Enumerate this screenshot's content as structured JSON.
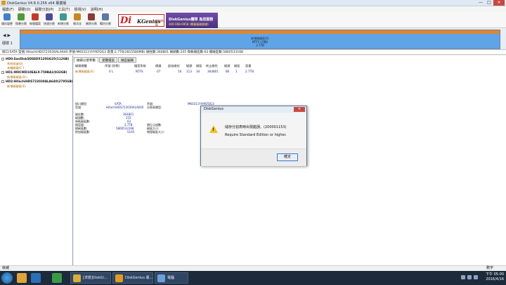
{
  "window": {
    "title": "DiskGenius V4.8.0.256 x64 專業版",
    "controls": [
      "—",
      "□",
      "×"
    ]
  },
  "menu": [
    "檔案(F)",
    "硬碟(D)",
    "磁碟分割(P)",
    "工具(T)",
    "檢視(V)",
    "說明(H)"
  ],
  "toolbar": [
    {
      "label": "儲存變更",
      "color": "#3f7fc9"
    },
    {
      "label": "搜尋分割",
      "color": "#4d9a3a"
    },
    {
      "label": "恢復檔案",
      "color": "#c23b2a"
    },
    {
      "label": "快速分割",
      "color": "#4b4b9a"
    },
    {
      "label": "新增分割",
      "color": "#3f9a8a"
    },
    {
      "label": "格式化",
      "color": "#c28a1c"
    },
    {
      "label": "刪除分割",
      "color": "#8a3a3a"
    },
    {
      "label": "備份分割",
      "color": "#5a7aa0"
    }
  ],
  "banner": {
    "logo_big": "Di",
    "logo_k": "KGenius",
    "logo_cn": "資料恢復",
    "ad_line1": "DiskGenius團隊 為您服務",
    "ad_line2": "400-008-9958 (專業服務熱線)"
  },
  "disk_bar": {
    "nav_arrows": "◀ ▶",
    "disk_label": "硬碟 1",
    "part_name": "新增磁碟區(E)",
    "part_fs": "NTFS (活動)",
    "part_size": "2.7TB"
  },
  "info_bar": "接口:SATA  型號:HitachiHDS723030ALA640  序號:MK0311YHYKFDG3  容量:2.7TB(2815580MB)  磁柱數:364801  磁頭數:255  每軌磁區數:63  總磁區數:5860533168",
  "tree": [
    {
      "type": "disk",
      "label": "HD0:SanDiskSDSSDX120GG25(112GB)"
    },
    {
      "type": "sub",
      "label": "系統保留(0)"
    },
    {
      "type": "sub",
      "label": "本機磁碟(C:)"
    },
    {
      "type": "disk",
      "label": "HD1:WDCWD10EALX-759BA1(932GB)"
    },
    {
      "type": "sub",
      "label": "新增磁碟區(D:)"
    },
    {
      "type": "disk",
      "label": "HD2:HitachiHDS723030ALA640(2795GB)"
    },
    {
      "type": "sub",
      "label": "新增磁碟區(E)"
    }
  ],
  "tabs": [
    "磁碟分割參數",
    "瀏覽檔案",
    "磁區編輯"
  ],
  "table": {
    "headers": [
      "磁碟標籤",
      "序號 (狀態)",
      "檔案系統",
      "標識",
      "起始磁柱",
      "磁頭",
      "磁區",
      "終止磁柱",
      "磁頭",
      "磁區",
      "容量"
    ],
    "row": [
      "新增磁碟區(E)",
      "0 L",
      "NTFS",
      "07",
      "16",
      "113",
      "34",
      "364801",
      "86",
      "1",
      "2.7TB"
    ]
  },
  "details": {
    "iface_label": "接口類型:",
    "iface_value": "SATA",
    "serial_label": "序號:",
    "serial_value": "MK0311YHYKFDG3",
    "model_label": "型號:",
    "model_value": "HitachiHDS723030ALA640",
    "part_type_label": "分割表類型:",
    "cyl_label": "磁柱數:",
    "cyl_value": "364801",
    "head_label": "磁頭數:",
    "head_value": "255",
    "spt_label": "每軌磁區數:",
    "spt_value": "63",
    "cap_label": "總容量:",
    "cap_value": "2.7TB",
    "sectors_label": "總磁區數:",
    "sectors_value": "5860533168",
    "add_label": "附加磁區數:",
    "add_value": "5165",
    "total_bytes_label": "總位元組數:",
    "sector_size_label": "磁區大小:",
    "phys_sector_label": "物理磁區大小:"
  },
  "dialog": {
    "title": "DiskGenius",
    "close": "×",
    "message_cn": "儲存分割表時出現錯誤。(200001153)",
    "message_en": "Require Standard Edition or higher.",
    "ok": "確定"
  },
  "status": {
    "left": "就緒",
    "right": "數字"
  },
  "taskbar": {
    "tasks": [
      {
        "label": "[求救]DiskGi...",
        "color": "#d8ad3a"
      },
      {
        "label": "DiskGenius 專...",
        "color": "#e29a24"
      },
      {
        "label": "電腦",
        "color": "#6aa1d8"
      }
    ],
    "time": "下午 05:00",
    "date": "2016/4/16"
  }
}
